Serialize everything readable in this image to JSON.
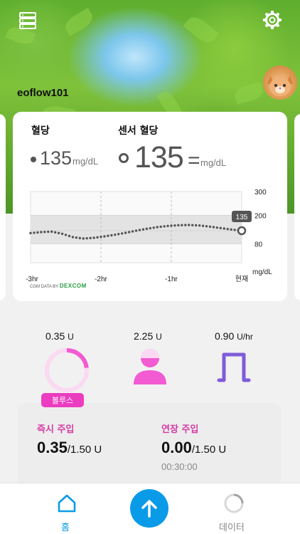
{
  "header": {
    "menu_icon": "menu-list-icon",
    "settings_icon": "gear-icon",
    "username": "eoflow101"
  },
  "glucose": {
    "bg_label": "혈당",
    "sensor_label": "센서 혈당",
    "bg_value": "135",
    "bg_unit": "mg/dL",
    "sensor_value": "135",
    "trend_symbol": "=",
    "sensor_unit": "mg/dL",
    "source_prefix": "CGM DATA BY",
    "source_brand": "DEXCOM"
  },
  "chart_data": {
    "type": "line",
    "x_ticks": [
      "-3hr",
      "-2hr",
      "-1hr",
      "현재"
    ],
    "y_ticks": [
      "300",
      "200",
      "80"
    ],
    "y_unit": "mg/dL",
    "target_range": [
      80,
      200
    ],
    "last_value_label": "135",
    "xlim": [
      -3,
      0
    ],
    "series": [
      {
        "x": [
          -3.0,
          -2.85,
          -2.7,
          -2.55,
          -2.4,
          -2.25,
          -2.1,
          -1.95,
          -1.8,
          -1.65,
          -1.5,
          -1.35,
          -1.2,
          -1.05,
          -0.9,
          -0.75,
          -0.6,
          -0.45,
          -0.3,
          -0.15,
          0.0
        ],
        "y": [
          125,
          129,
          131,
          122,
          108,
          102,
          105,
          111,
          118,
          126,
          135,
          143,
          150,
          155,
          158,
          159,
          157,
          152,
          146,
          140,
          135
        ]
      }
    ],
    "colors": {
      "dots": "#555555",
      "range_band": "#e3e3e3",
      "high_tick": "#e5a10b",
      "low_tick": "#e23a78"
    }
  },
  "pump": {
    "bolus_value": "0.35",
    "bolus_unit": "U",
    "remaining_value": "2.25",
    "remaining_unit": "U",
    "basal_value": "0.90",
    "basal_unit": "U/hr",
    "bolus_badge": "볼루스",
    "bolus_progress": 0.23,
    "colors": {
      "pink": "#f25bd2",
      "basal": "#7f5cd9"
    }
  },
  "infusion": {
    "immediate_label": "즉시 주입",
    "immediate_value": "0.35",
    "immediate_total": "/1.50 U",
    "extended_label": "연장 주입",
    "extended_value": "0.00",
    "extended_total": "/1.50 U",
    "extended_time": "00:30:00"
  },
  "nav": {
    "home_label": "홈",
    "data_label": "데이터",
    "home_icon": "home-icon",
    "fab_icon": "arrow-up-icon",
    "data_icon": "loading-ring-icon",
    "active_color": "#0a9be8"
  }
}
